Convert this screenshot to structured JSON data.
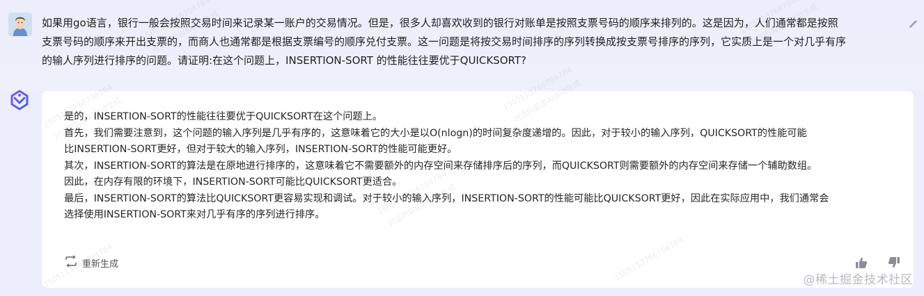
{
  "user_message": {
    "lines": [
      "如果用go语言，银行一般会按照交易时间来记录某一账户的交易情况。但是，很多人却喜欢收到的银行对账单是按照支票号码的顺序来排列的。这是因为，人们通常都是按照",
      "支票号码的顺序来开出支票的，而商人也通常都是根据支票编号的顺序兑付支票。这一问题是将按交易时间排序的序列转换成按支票号排序的序列，它实质上是一个对几乎有序",
      "的输人序列进行排序的问题。请证明:在这个问题上，INSERTION-SORT 的性能往往要优于QUICKSORT?"
    ]
  },
  "answer": {
    "lines": [
      "是的，INSERTION-SORT的性能往往要优于QUICKSORT在这个问题上。",
      "首先，我们需要注意到，这个问题的输入序列是几乎有序的，这意味着它的大小是以O(nlogn)的时间复杂度递增的。因此，对于较小的输入序列，QUICKSORT的性能可能",
      "比INSERTION-SORT更好，但对于较大的输入序列，INSERTION-SORT的性能可能更好。",
      "其次，INSERTION-SORT的算法是在原地进行排序的，这意味着它不需要额外的内存空间来存储排序后的序列，而QUICKSORT则需要额外的内存空间来存储一个辅助数组。",
      "因此，在内存有限的环境下，INSERTION-SORT可能比QUICKSORT更适合。",
      "最后，INSERTION-SORT的算法比QUICKSORT更容易实现和调试。对于较小的输入序列，INSERTION-SORT的性能可能比QUICKSORT更好，因此在实际应用中，我们通常会",
      "选择使用INSERTION-SORT来对几乎有序的序列进行排序。"
    ],
    "regenerate_label": "重新生成"
  },
  "watermark": {
    "site": "@稀土掘金技术社区",
    "tiles": [
      "15051137667047B4",
      "对话内容由AI自动生成"
    ]
  },
  "colors": {
    "page_bg": "#edeefb",
    "card_bg": "#ffffff",
    "text": "#262626",
    "icon_gray": "#8a8c99"
  },
  "icons": {
    "avatar": "user-avatar-icon",
    "bot": "bot-logo-icon",
    "edit": "edit-icon",
    "regenerate": "regenerate-icon",
    "like": "thumbs-up-icon",
    "dislike": "thumbs-down-icon"
  }
}
